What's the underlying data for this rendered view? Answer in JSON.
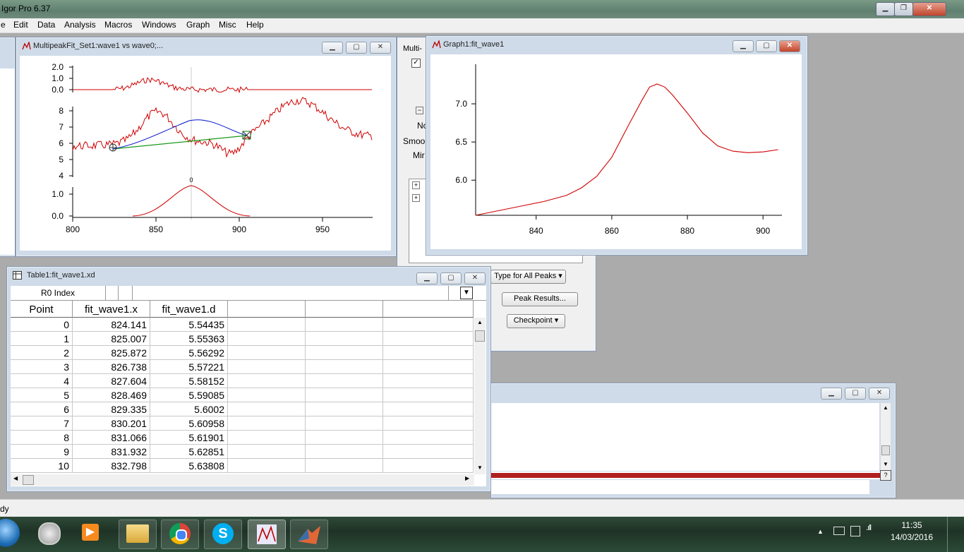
{
  "app": {
    "title": "Igor Pro 6.37"
  },
  "menu": [
    "e",
    "Edit",
    "Data",
    "Analysis",
    "Macros",
    "Windows",
    "Graph",
    "Misc",
    "Help"
  ],
  "multipeak_window": {
    "title": "MultipeakFit_Set1:wave1 vs wave0;...",
    "top_yticks": [
      "2.0",
      "1.0",
      "0.0"
    ],
    "mid_yticks": [
      "8",
      "7",
      "6",
      "5",
      "4"
    ],
    "bottom_yticks": [
      "1.0",
      "0.0"
    ],
    "xticks": [
      "800",
      "850",
      "900",
      "950"
    ],
    "peak_label": "0"
  },
  "graph1": {
    "title": "Graph1:fit_wave1",
    "chart_data": {
      "type": "line",
      "x": [
        824,
        830,
        836,
        842,
        848,
        852,
        856,
        860,
        864,
        868,
        870,
        872,
        874,
        876,
        880,
        884,
        888,
        892,
        896,
        900,
        904
      ],
      "y": [
        5.54,
        5.6,
        5.66,
        5.72,
        5.8,
        5.9,
        6.05,
        6.3,
        6.68,
        7.05,
        7.22,
        7.26,
        7.22,
        7.12,
        6.88,
        6.62,
        6.45,
        6.38,
        6.36,
        6.37,
        6.4
      ],
      "xticks": [
        "840",
        "860",
        "880",
        "900"
      ],
      "yticks": [
        "7.0",
        "6.5",
        "6.0"
      ],
      "xlim": [
        824,
        905
      ],
      "ylim": [
        5.54,
        7.5
      ],
      "line_color": "#d00000"
    }
  },
  "table1": {
    "title": "Table1:fit_wave1.xd",
    "cell_ref": "R0 Index",
    "headers": [
      "Point",
      "fit_wave1.x",
      "fit_wave1.d"
    ],
    "rows": [
      [
        "0",
        "824.141",
        "5.54435"
      ],
      [
        "1",
        "825.007",
        "5.55363"
      ],
      [
        "2",
        "825.872",
        "5.56292"
      ],
      [
        "3",
        "826.738",
        "5.57221"
      ],
      [
        "4",
        "827.604",
        "5.58152"
      ],
      [
        "5",
        "828.469",
        "5.59085"
      ],
      [
        "6",
        "829.335",
        "5.6002"
      ],
      [
        "7",
        "830.201",
        "5.60958"
      ],
      [
        "8",
        "831.066",
        "5.61901"
      ],
      [
        "9",
        "831.932",
        "5.62851"
      ],
      [
        "10",
        "832.798",
        "5.63808"
      ]
    ]
  },
  "multipeak_panel": {
    "title_partial": "Multi-",
    "labels": [
      "No",
      "Smoo",
      "Mir"
    ],
    "type_button": "Type for All Peaks",
    "peak_results_button": "Peak Results...",
    "checkpoint_button": "Checkpoint"
  },
  "status": {
    "text": "dy"
  },
  "taskbar": {
    "time": "11:35",
    "date": "14/03/2016"
  }
}
